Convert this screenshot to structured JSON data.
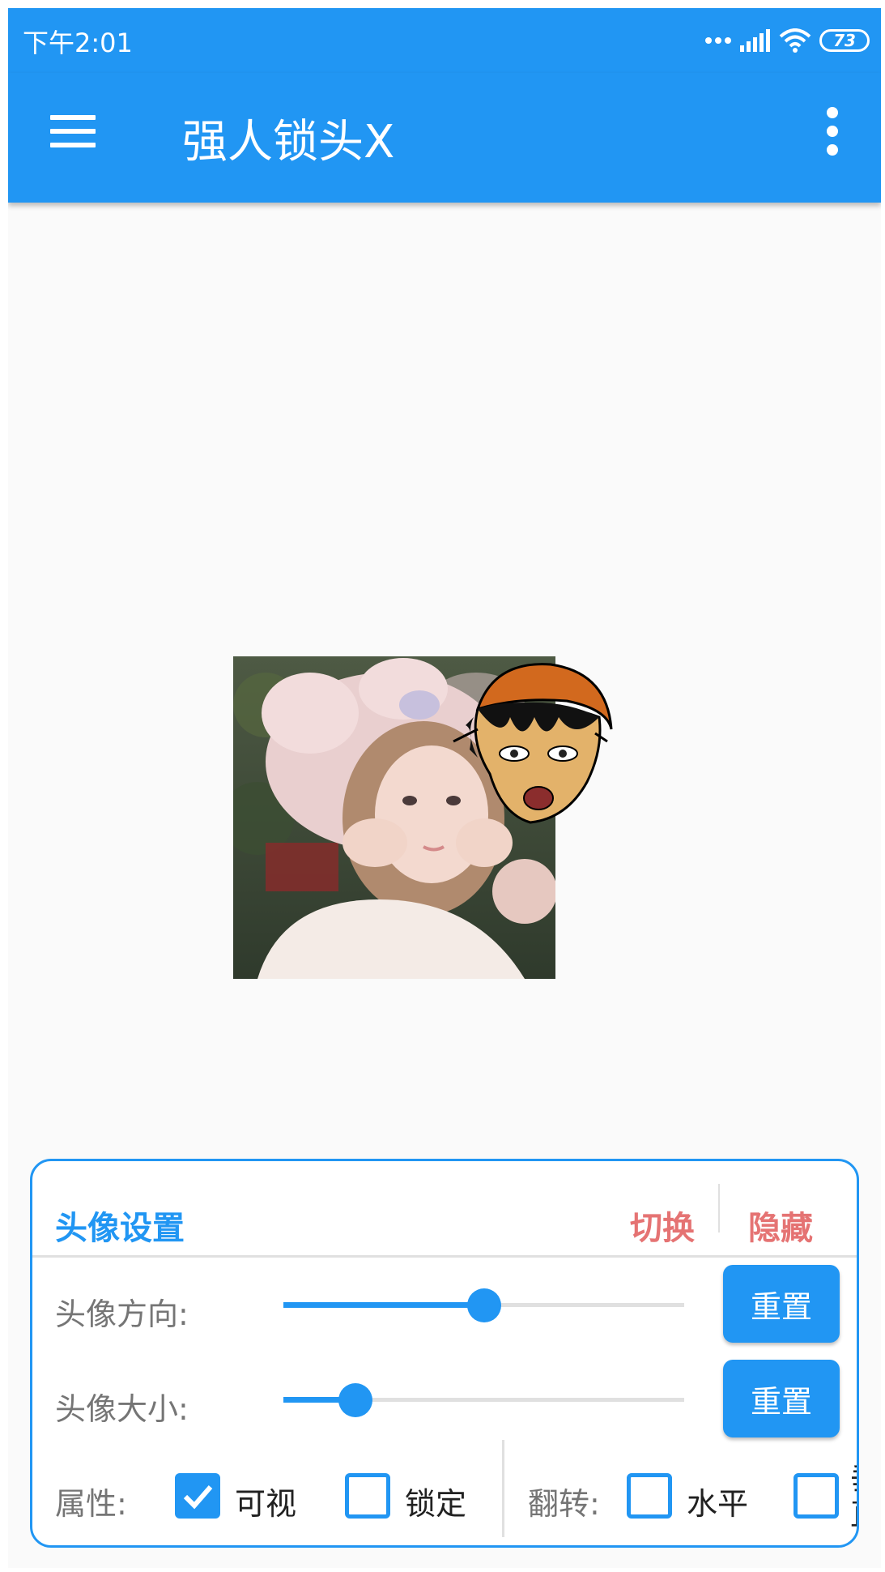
{
  "status_bar": {
    "time": "下午2:01",
    "battery": "73"
  },
  "app_bar": {
    "title": "强人锁头X"
  },
  "panel": {
    "title": "头像设置",
    "switch_label": "切换",
    "hide_label": "隐藏",
    "direction": {
      "label": "头像方向:",
      "value_fraction": 0.5,
      "reset_label": "重置"
    },
    "size": {
      "label": "头像大小:",
      "value_fraction": 0.18,
      "reset_label": "重置"
    },
    "attributes": {
      "label": "属性:",
      "visible_label": "可视",
      "visible_checked": true,
      "lock_label": "锁定",
      "lock_checked": false
    },
    "flip": {
      "label": "翻转:",
      "horizontal_label": "水平",
      "horizontal_checked": false,
      "vertical_label": "垂直",
      "vertical_checked": false
    }
  },
  "colors": {
    "primary": "#2196f3",
    "accent_red": "#e57373",
    "background": "#fafafa"
  }
}
